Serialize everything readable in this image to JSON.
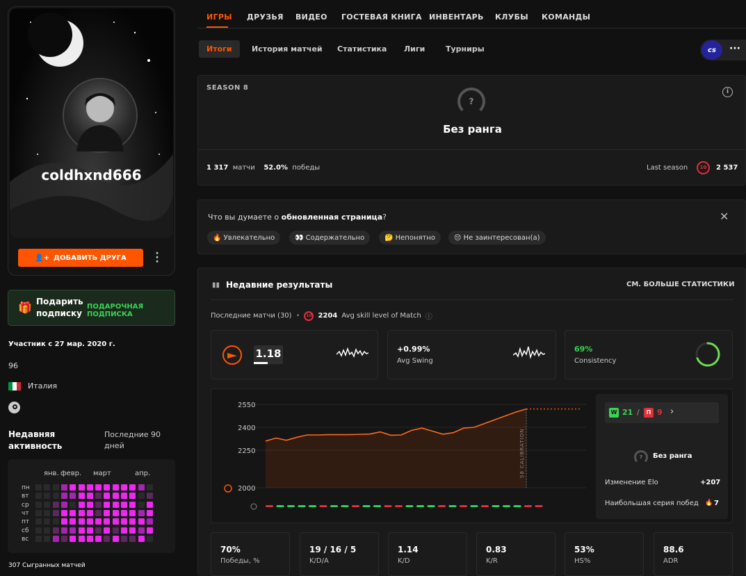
{
  "profile": {
    "username": "coldhxnd666",
    "add_friend": "ДОБАВИТЬ ДРУГА",
    "gift_title": "Подарить подписку",
    "gift_tag": "ПОДАРОЧНАЯ ПОДПИСКА",
    "member_since": "Участник с 27 мар. 2020 г.",
    "number": "96",
    "country": "Италия",
    "activity_title": "Недавняя активность",
    "activity_period": "Последние 90 дней",
    "months": [
      "янв.",
      "февр.",
      "март",
      "апр."
    ],
    "weekdays": [
      "пн",
      "вт",
      "ср",
      "чт",
      "пт",
      "сб",
      "вс"
    ],
    "played": "307 Сыгранных матчей"
  },
  "tabs": [
    "ИГРЫ",
    "ДРУЗЬЯ",
    "ВИДЕО",
    "ГОСТЕВАЯ КНИГА",
    "ИНВЕНТАРЬ",
    "КЛУБЫ",
    "КОМАНДЫ"
  ],
  "subtabs": [
    "Итоги",
    "История матчей",
    "Статистика",
    "Лиги",
    "Турниры"
  ],
  "game_badge": "cs",
  "season": {
    "label": "SEASON 8",
    "rank": "Без ранга",
    "rank_icon": "?",
    "matches_value": "1 317",
    "matches_label": "матчи",
    "wins_value": "52.0%",
    "wins_label": "победы",
    "last_season_label": "Last season",
    "last_level": "10",
    "last_elo": "2 537"
  },
  "feedback": {
    "question": "Что вы думаете о",
    "question_bold": "обновленная страница",
    "question_end": "?",
    "options": [
      "🔥 Увлекательно",
      "👀 Содержательно",
      "🤔 Непонятно",
      "😔 Не заинтересован(а)"
    ]
  },
  "recent": {
    "title": "Недавние результаты",
    "more": "СМ. БОЛЬШЕ СТАТИСТИКИ",
    "last_matches": "Последние матчи (30)",
    "level": "10",
    "avg_skill": "2204",
    "avg_label": "Avg skill level of Match",
    "rating": "1.18",
    "swing_value": "+0.99%",
    "swing_label": "Avg Swing",
    "consistency_value": "69%",
    "consistency_label": "Consistency",
    "consistency_pct": 69
  },
  "chart_data": {
    "type": "line",
    "y_ticks": [
      "2550",
      "2400",
      "2250",
      "2000"
    ],
    "ylim": [
      2000,
      2620
    ],
    "values": [
      2310,
      2330,
      2315,
      2335,
      2350,
      2350,
      2352,
      2352,
      2352,
      2354,
      2356,
      2370,
      2348,
      2350,
      2380,
      2395,
      2375,
      2355,
      2365,
      2395,
      2400,
      2425,
      2450,
      2475,
      2500,
      2520
    ],
    "calibration_label": "S8 CALIBRATION",
    "projection": 2520,
    "results": [
      "L",
      "W",
      "W",
      "W",
      "W",
      "L",
      "W",
      "W",
      "L",
      "W",
      "W",
      "L",
      "L",
      "W",
      "W",
      "W",
      "L",
      "W",
      "L",
      "W",
      "L",
      "W",
      "W",
      "W",
      "L",
      "L"
    ]
  },
  "summary": {
    "w_label": "W",
    "wins": "21",
    "l_label": "П",
    "losses": "9",
    "rank": "Без ранга",
    "elo_change_label": "Изменение Elo",
    "elo_change": "+207",
    "streak_label": "Наибольшая серия побед",
    "streak": "7"
  },
  "stats": [
    {
      "value": "70%",
      "label": "Победы, %"
    },
    {
      "value": "19 / 16 / 5",
      "label": "K/D/A"
    },
    {
      "value": "1.14",
      "label": "K/D"
    },
    {
      "value": "0.83",
      "label": "K/R"
    },
    {
      "value": "53%",
      "label": "HS%"
    },
    {
      "value": "88.6",
      "label": "ADR"
    }
  ],
  "colors": {
    "accent": "#ff5500",
    "win": "#2fd35a",
    "loss": "#e0303a",
    "chart_line": "#ff6a1a"
  }
}
